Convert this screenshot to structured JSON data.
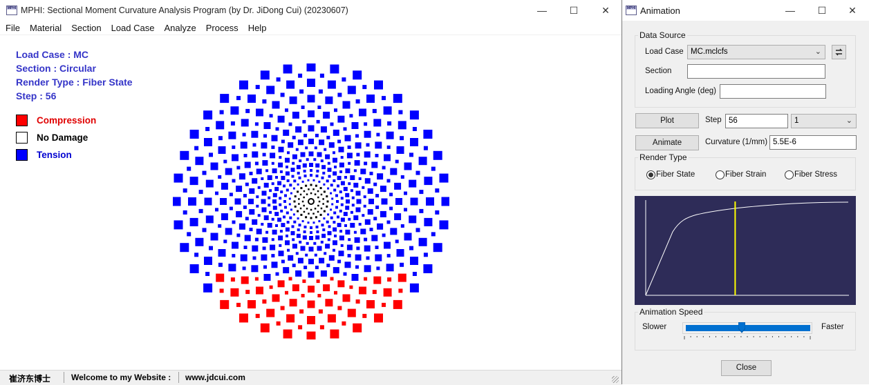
{
  "main_window": {
    "app_icon_text": "MPHI",
    "title": "MPHI: Sectional Moment Curvature Analysis Program (by Dr. JiDong Cui) (20230607)",
    "menu": [
      "File",
      "Material",
      "Section",
      "Load Case",
      "Analyze",
      "Process",
      "Help"
    ],
    "info": {
      "load_case": "Load Case : MC",
      "section": "Section : Circular",
      "render_type": "Render Type : Fiber State",
      "step": "Step : 56"
    },
    "legend": [
      {
        "label": "Compression",
        "color": "#ff0000",
        "text_color": "#e00000"
      },
      {
        "label": "No Damage",
        "color": "#ffffff",
        "text_color": "#000000"
      },
      {
        "label": "Tension",
        "color": "#0000ff",
        "text_color": "#0000d0"
      }
    ],
    "status": {
      "author": "崔济东博士",
      "welcome": "Welcome to my Website :",
      "website": "www.jdcui.com"
    },
    "colors": {
      "compression": "#ff0000",
      "tension": "#0000ff",
      "core": "#000000"
    }
  },
  "anim_window": {
    "title": "Animation",
    "data_source": {
      "group_title": "Data Source",
      "load_case_label": "Load Case",
      "load_case_value": "MC.mclcfs",
      "section_label": "Section",
      "section_value": "",
      "loading_angle_label": "Loading Angle (deg)",
      "loading_angle_value": ""
    },
    "plot_button": "Plot",
    "step_label": "Step",
    "step_value": "56",
    "step_increment": "1",
    "animate_button": "Animate",
    "curvature_label": "Curvature (1/mm)",
    "curvature_value": "5.5E-6",
    "render_type": {
      "group_title": "Render Type",
      "options": [
        "Fiber State",
        "Fiber Strain",
        "Fiber Stress"
      ],
      "selected": "Fiber State"
    },
    "curve": {
      "background": "#2e2c58",
      "line_color": "#ffffff",
      "marker_color": "#ffff00",
      "marker_fraction": 0.44
    },
    "speed": {
      "group_title": "Animation Speed",
      "slower_label": "Slower",
      "faster_label": "Faster",
      "value_fraction": 0.45
    },
    "close_button": "Close"
  }
}
